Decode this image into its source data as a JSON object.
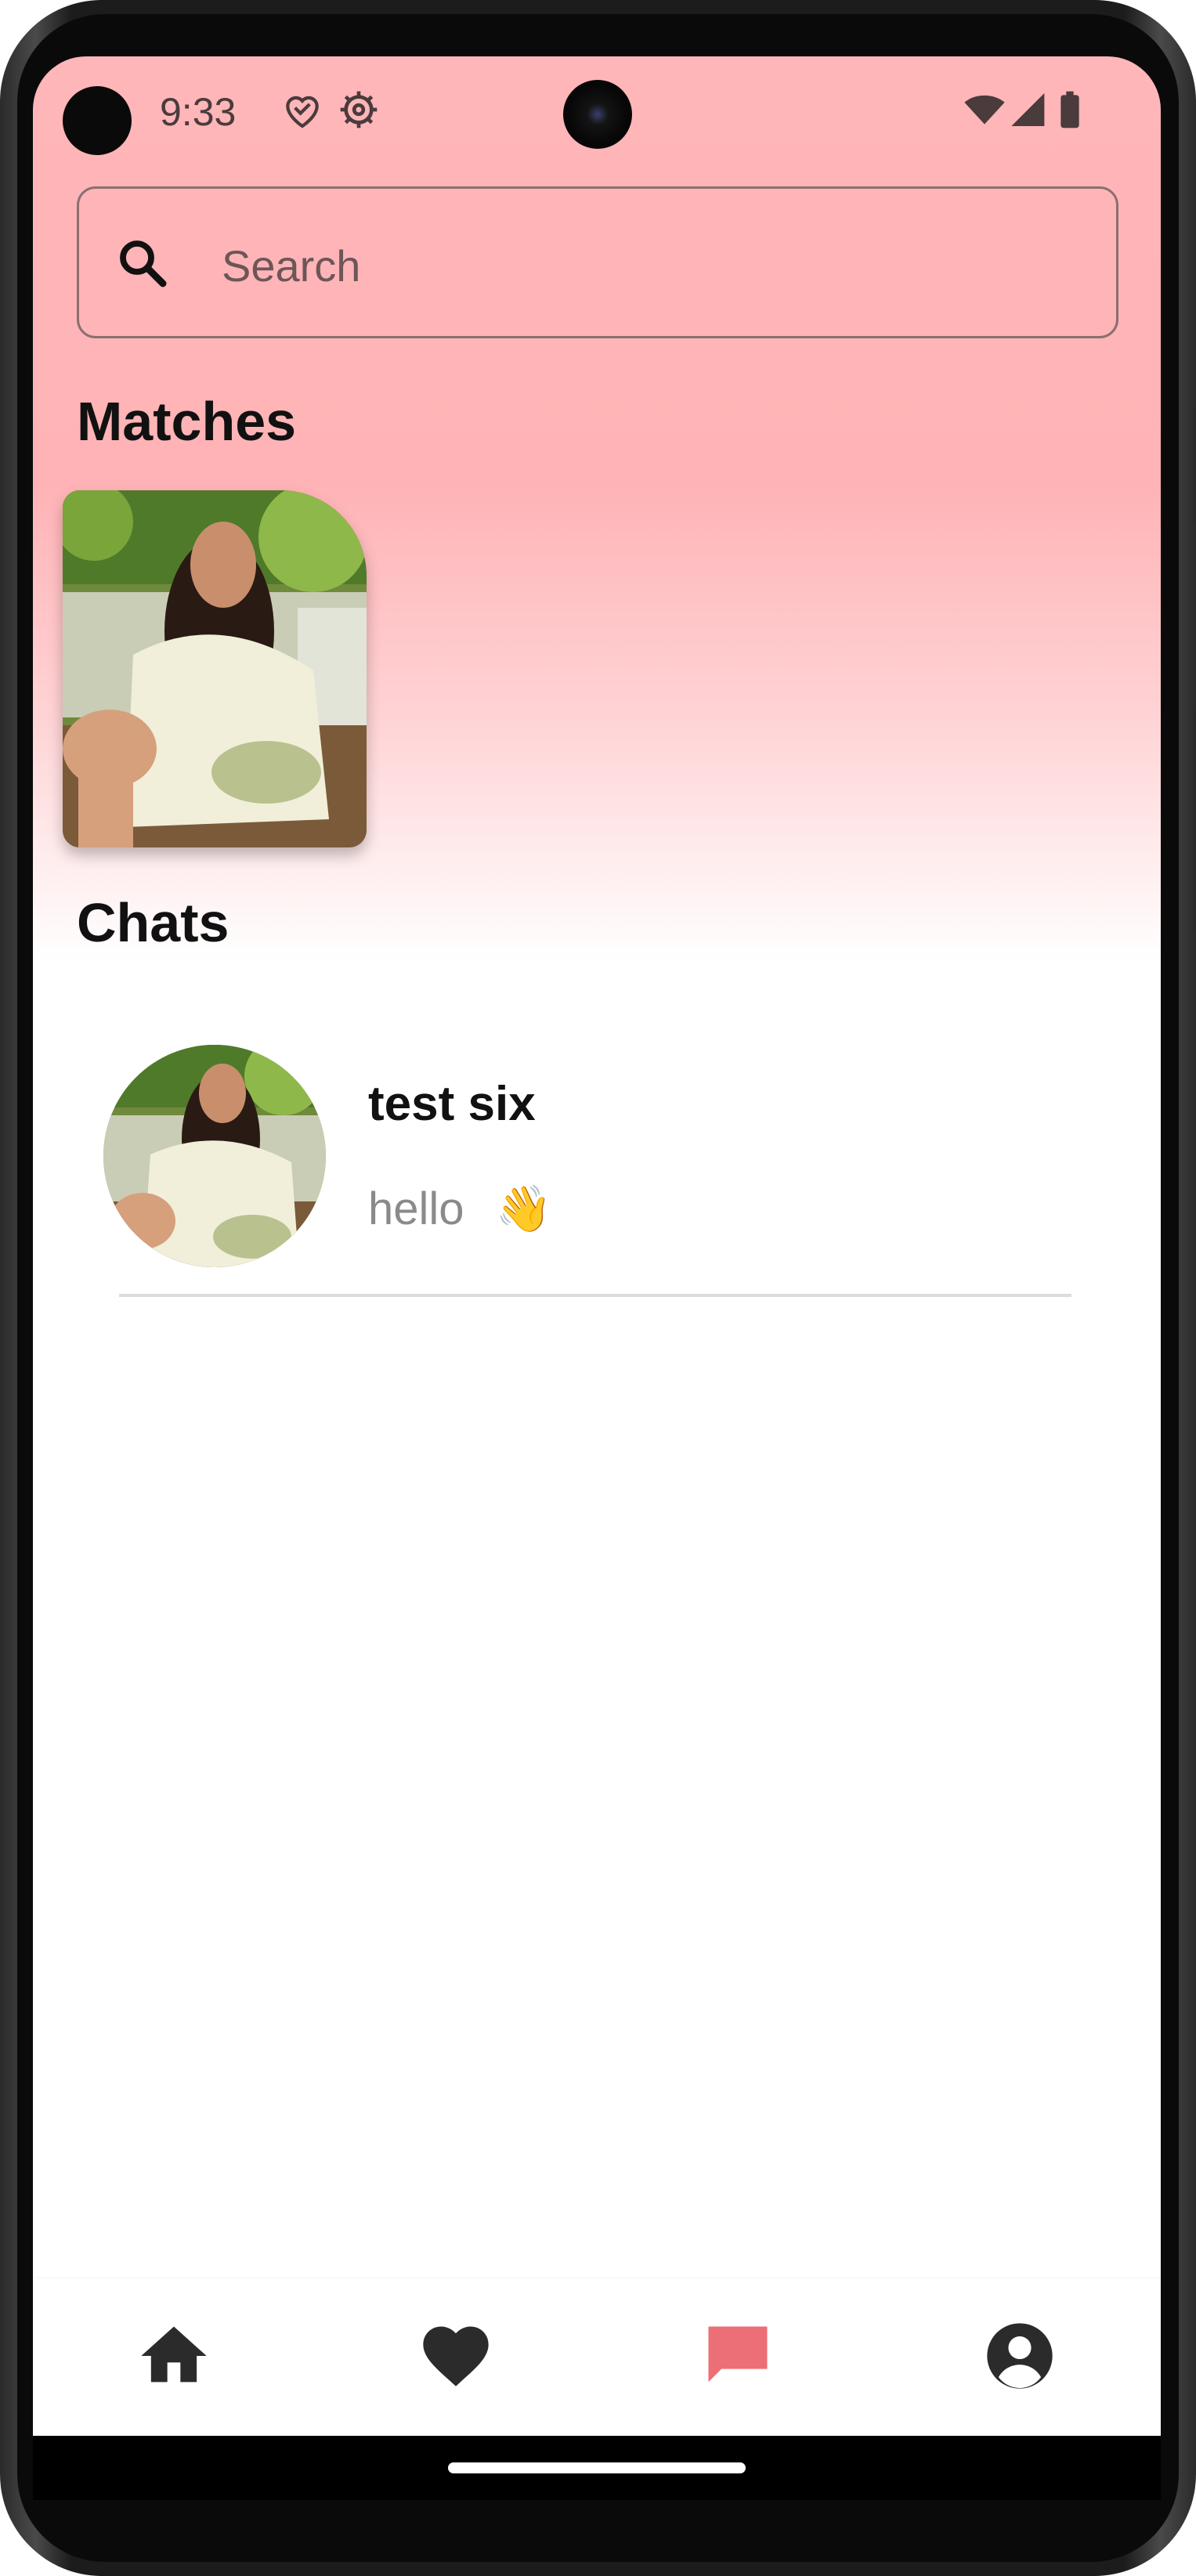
{
  "status_bar": {
    "time": "9:33",
    "icons": [
      "heart-shield-icon",
      "gear-icon",
      "wifi-icon",
      "signal-icon",
      "battery-icon"
    ]
  },
  "search": {
    "placeholder": "Search",
    "icon": "search-icon"
  },
  "matches": {
    "title": "Matches",
    "items": [
      {
        "image": "profile-photo"
      }
    ]
  },
  "chats": {
    "title": "Chats",
    "items": [
      {
        "name": "test six",
        "preview": "hello",
        "emoji": "👋",
        "avatar": "profile-photo"
      }
    ]
  },
  "bottom_nav": {
    "items": [
      {
        "icon": "home-icon",
        "active": false
      },
      {
        "icon": "heart-icon",
        "active": false
      },
      {
        "icon": "chat-icon",
        "active": true
      },
      {
        "icon": "account-icon",
        "active": false
      }
    ],
    "active_color": "#EC6E76",
    "inactive_color": "#2B2B2B"
  },
  "colors": {
    "header_gradient_top": "#FFB6B9",
    "background": "#FFFFFF"
  }
}
